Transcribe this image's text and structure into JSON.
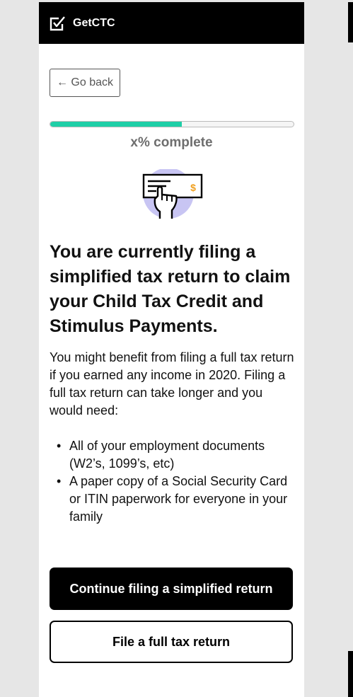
{
  "header": {
    "brand": "GetCTC",
    "logo_icon": "checkbox-check-icon"
  },
  "nav": {
    "back_label": "← Go back"
  },
  "progress": {
    "fraction": 0.54,
    "label": "x% complete",
    "fill_color": "#1ecfa7"
  },
  "illustration": {
    "icon": "hand-holding-check-icon",
    "dollar_sign": "$",
    "accent_color": "#c8c5f3",
    "dollar_color": "#f0a020"
  },
  "content": {
    "title": "You are currently filing a simplified tax return to claim your Child Tax Credit and Stimulus Payments.",
    "intro": "You might benefit from filing a full tax return if you earned any income in 2020. Filing a full tax return can take longer and you would need:",
    "bullets": [
      "All of your employment documents (W2’s, 1099’s, etc)",
      "A paper copy of a Social Security Card or ITIN paperwork for everyone in your family"
    ]
  },
  "actions": {
    "primary_label": "Continue filing a simplified return",
    "secondary_label": "File a full tax return"
  }
}
